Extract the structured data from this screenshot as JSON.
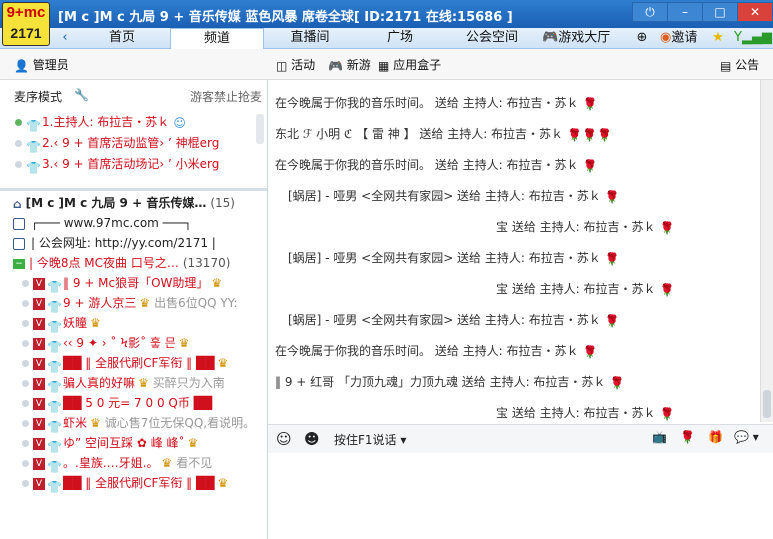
{
  "logo": {
    "line1": "9+mc",
    "line2": "2171"
  },
  "window": {
    "title": "[M c ]M c 九局  9 + 音乐传媒  蓝色风暴 席卷全球[ ID:2171  在线:15686 ]"
  },
  "nav": {
    "items": [
      "首页",
      "频道",
      "直播间",
      "广场",
      "公会空间"
    ],
    "active_index": 1,
    "game_hall": "游戏大厅 (1)",
    "invite": "邀请"
  },
  "toolbar": {
    "admin": "管理员",
    "activity": "活动",
    "new_game": "新游",
    "app_box": "应用盒子",
    "announcement": "公告"
  },
  "mic": {
    "mode": "麦序模式",
    "guest_hint": "游客禁止抢麦",
    "list": [
      {
        "num": "1.",
        "text": "主持人: 布拉吉・苏ｋ",
        "active": true
      },
      {
        "num": "2.",
        "text": "‹ 9 + 首席活动监管› ’  神棍erg",
        "active": false
      },
      {
        "num": "3.",
        "text": "‹ 9 + 首席活动场记› ’  小米erg",
        "active": false
      }
    ]
  },
  "tree": {
    "channel_name": "[M c ]M c 九局  9 + 音乐传媒…",
    "channel_count": "(15)",
    "rows": [
      "┌───  www.97mc.com  ───┐",
      "| 公会网址: http://yy.com/2171 |",
      "|   今晚8点  MC夜曲 口号之…"
    ],
    "group_count": "(13170)",
    "users": [
      "‖ 9 + Mc狼哥「OW助理」",
      "9 + 游人京三",
      "妖瞳",
      "‹‹ 9 ✦ › ˚  Ϟ影˚ 훟 믄",
      "██ ‖ 全服代刷CF军衔 ‖ ██",
      "骗人真的好嘛",
      "██  5 0 元= 7 0 0 Q币 ██",
      "虾米",
      "ゆ”  空间互踩  ✿  峰  峰˚",
      "。.皇族.…牙姐.。",
      "██ ‖ 全服代刷CF军衔 ‖ ██"
    ],
    "extras": {
      "u2": "出售6位QQ  YY:",
      "u6": "买醉只为入南",
      "u8": "诚心售7位无保QQ,看说明。",
      "u10": "看不见"
    }
  },
  "chat": {
    "messages": [
      "在今晚属于你我的音乐时间。  送给 主持人: 布拉吉・苏ｋ",
      "东北 ℱ 小明 ℭ  【  雷   神  】 送给 主持人: 布拉吉・苏ｋ",
      "在今晚属于你我的音乐时间。  送给 主持人: 布拉吉・苏ｋ",
      "[蜗居] -   哑男  <全网共有家园>  送给 主持人: 布拉吉・苏ｋ",
      "宝  送给 主持人: 布拉吉・苏ｋ",
      "[蜗居] -   哑男  <全网共有家园>  送给 主持人: 布拉吉・苏ｋ",
      "宝  送给 主持人: 布拉吉・苏ｋ",
      "[蜗居] -   哑男  <全网共有家园>  送给 主持人: 布拉吉・苏ｋ",
      "在今晚属于你我的音乐时间。  送给 主持人: 布拉吉・苏ｋ",
      "‖ 9 +  红哥  「力顶九魂」力顶九魂  送给 主持人: 布拉吉・苏ｋ",
      "宝  送给 主持人: 布拉吉・苏ｋ"
    ]
  },
  "input": {
    "mode": "按住F1说话"
  },
  "colors": {
    "accent": "#1a5fb4",
    "rose": "#d0101c",
    "nick": "#d0101c"
  }
}
